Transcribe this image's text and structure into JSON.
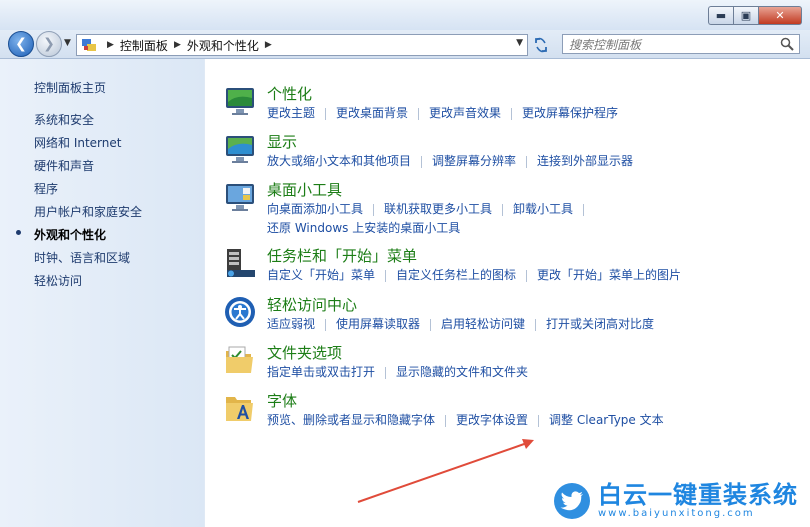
{
  "window": {
    "buttons": {
      "minimize": "▬",
      "maximize": "▣",
      "close": "✕"
    }
  },
  "nav": {
    "breadcrumb": [
      "控制面板",
      "外观和个性化"
    ],
    "search_placeholder": "搜索控制面板"
  },
  "sidebar": {
    "items": [
      {
        "label": "控制面板主页"
      },
      {
        "label": "系统和安全"
      },
      {
        "label": "网络和 Internet"
      },
      {
        "label": "硬件和声音"
      },
      {
        "label": "程序"
      },
      {
        "label": "用户帐户和家庭安全"
      },
      {
        "label": "外观和个性化",
        "current": true
      },
      {
        "label": "时钟、语言和区域"
      },
      {
        "label": "轻松访问"
      }
    ]
  },
  "categories": [
    {
      "title": "个性化",
      "icon": "personalization-icon",
      "links": [
        [
          "更改主题",
          "更改桌面背景",
          "更改声音效果",
          "更改屏幕保护程序"
        ]
      ]
    },
    {
      "title": "显示",
      "icon": "display-icon",
      "links": [
        [
          "放大或缩小文本和其他项目",
          "调整屏幕分辨率",
          "连接到外部显示器"
        ]
      ]
    },
    {
      "title": "桌面小工具",
      "icon": "gadgets-icon",
      "links": [
        [
          "向桌面添加小工具",
          "联机获取更多小工具",
          "卸载小工具"
        ],
        [
          "还原 Windows 上安装的桌面小工具"
        ]
      ]
    },
    {
      "title": "任务栏和「开始」菜单",
      "icon": "taskbar-icon",
      "links": [
        [
          "自定义「开始」菜单",
          "自定义任务栏上的图标",
          "更改「开始」菜单上的图片"
        ]
      ]
    },
    {
      "title": "轻松访问中心",
      "icon": "ease-of-access-icon",
      "links": [
        [
          "适应弱视",
          "使用屏幕读取器",
          "启用轻松访问键",
          "打开或关闭高对比度"
        ]
      ]
    },
    {
      "title": "文件夹选项",
      "icon": "folder-options-icon",
      "links": [
        [
          "指定单击或双击打开",
          "显示隐藏的文件和文件夹"
        ]
      ]
    },
    {
      "title": "字体",
      "icon": "fonts-icon",
      "links": [
        [
          "预览、删除或者显示和隐藏字体",
          "更改字体设置",
          "调整 ClearType 文本"
        ]
      ]
    }
  ],
  "watermark": {
    "title": "白云一键重装系统",
    "url": "www.baiyunxitong.com"
  },
  "colors": {
    "link": "#1f4fa3",
    "category_title": "#1c7d16",
    "arrow": "#e04b3a"
  }
}
